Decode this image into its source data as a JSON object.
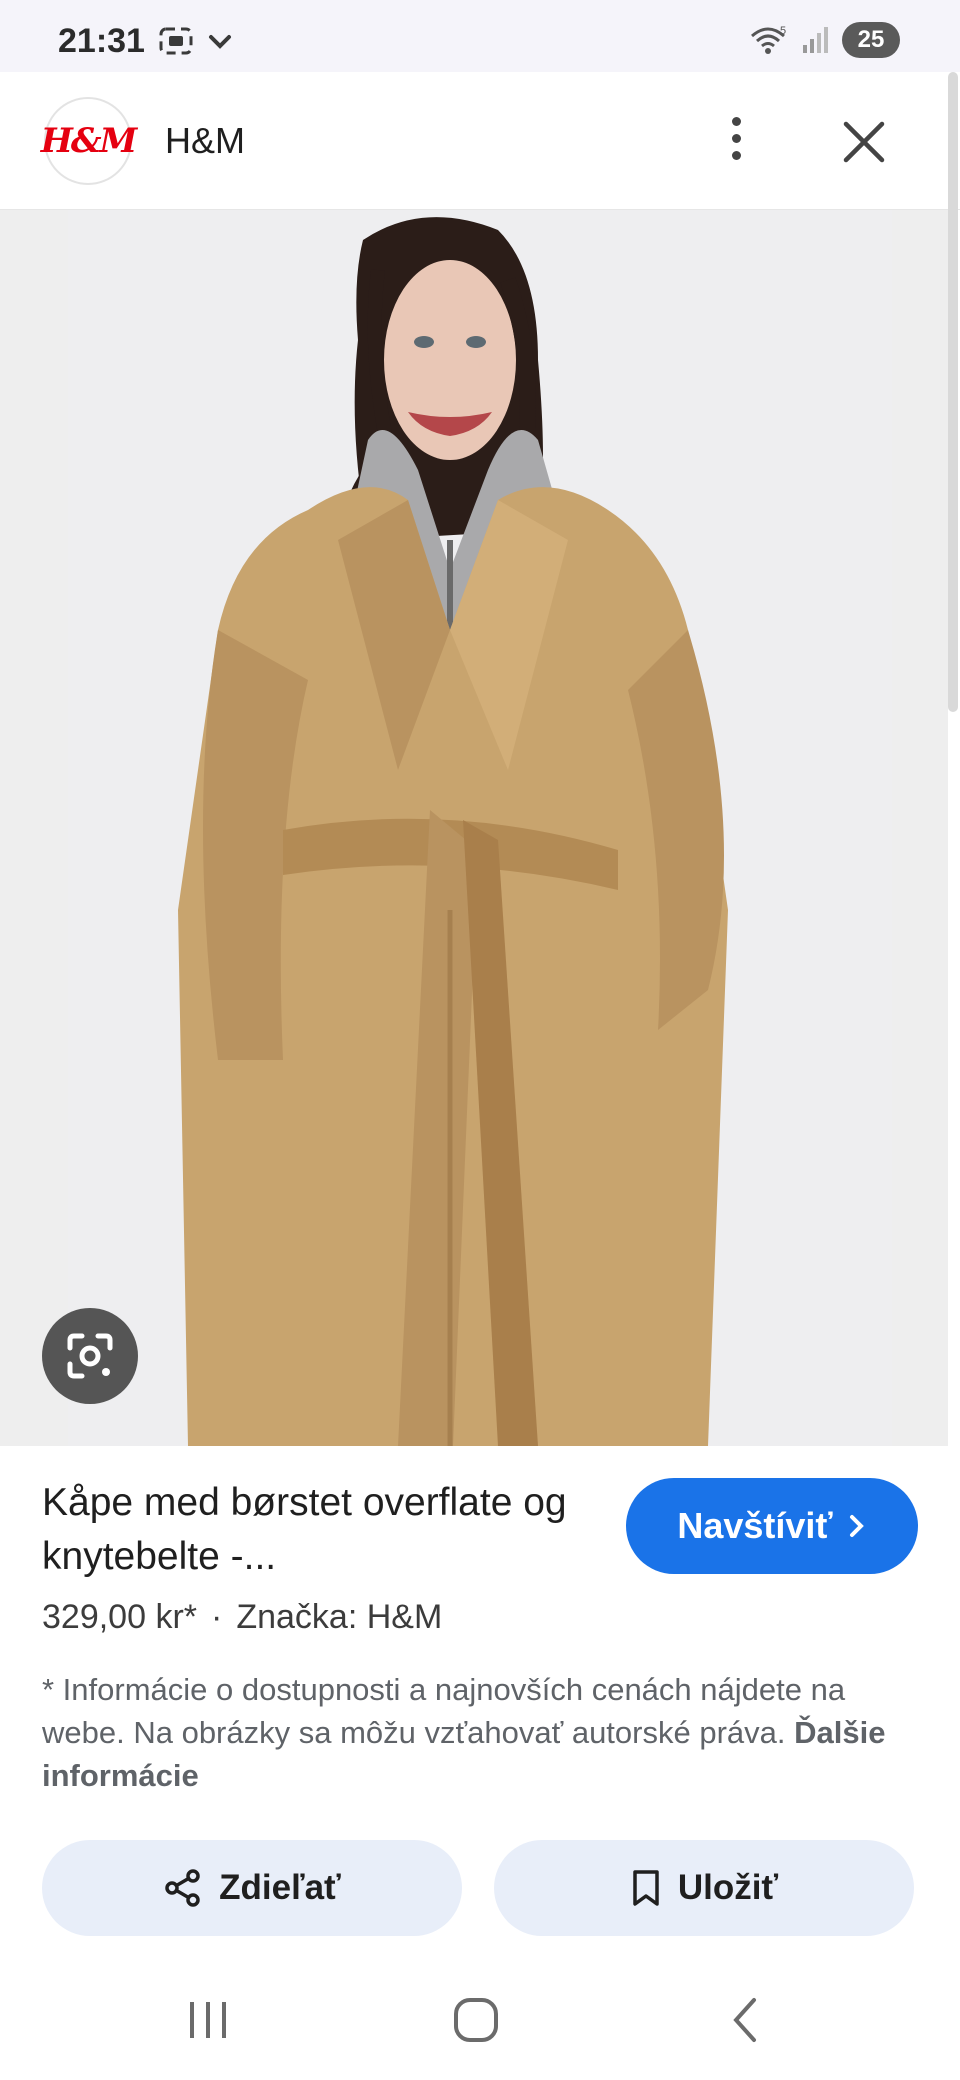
{
  "status_bar": {
    "time": "21:31",
    "battery": "25"
  },
  "header": {
    "logo_text": "H&M",
    "title": "H&M"
  },
  "product": {
    "title": "Kåpe med børstet overflate og knytebelte -...",
    "visit_label": "Navštíviť",
    "price": "329,00 kr*",
    "separator": "·",
    "brand": "Značka: H&M",
    "disclaimer": "* Informácie o dostupnosti a najnovších cenách nájdete na webe. Na obrázky sa môžu vzťahovať autorské práva.",
    "more_info": "Ďalšie informácie"
  },
  "actions": {
    "share_label": "Zdieľať",
    "save_label": "Uložiť"
  },
  "icons": {
    "lens": "google-lens-icon",
    "share": "share-icon",
    "bookmark": "bookmark-icon",
    "close": "close-icon",
    "more": "more-vert-icon"
  },
  "colors": {
    "accent": "#1a73e8",
    "action_bg": "#e8eef9",
    "brand_red": "#e50010",
    "coat": "#c8a46e"
  }
}
